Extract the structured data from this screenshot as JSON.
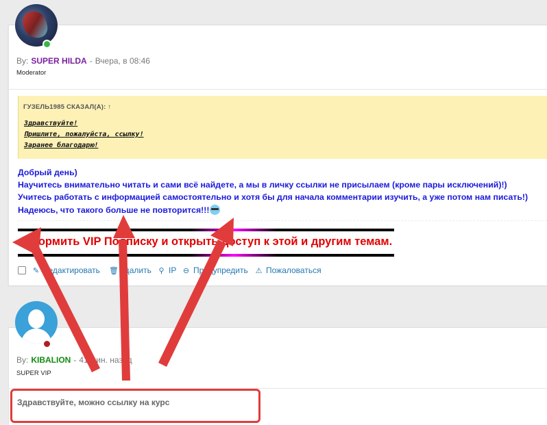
{
  "post1": {
    "by_label": "By:",
    "author": "SUPER HILDA",
    "author_color": "#7a1fa0",
    "separator": "-",
    "time": "Вчера, в 08:46",
    "role": "Moderator",
    "quote": {
      "header": "ГУЗЕЛЬ1985 СКАЗАЛ(А): ↑",
      "lines": [
        "Здравствуйте!",
        "Пришлите, пожалуйста, ссылку!",
        "Заранее благодарю!"
      ]
    },
    "reply_lines": [
      "Добрый день)",
      "Научитесь внимательно читать и сами всё найдете, а мы в личку ссылки не присылаем (кроме пары исключений)!)",
      "Учитесь работать с информацией самостоятельно и хотя бы для начала комментарии изучить, а уже потом нам писать!)",
      "Надеюсь, что такого больше не повторится!!!"
    ],
    "vip_banner": "Оформить VIP Подписку и открыть доступ к этой и другим темам.",
    "actions": [
      {
        "label": "Редактировать",
        "icon": "edit-icon"
      },
      {
        "label": "Удалить",
        "icon": "trash-icon"
      },
      {
        "label": "IP",
        "icon": "user-ip-icon"
      },
      {
        "label": "Предупредить",
        "icon": "warn-circle-icon"
      },
      {
        "label": "Пожаловаться",
        "icon": "report-triangle-icon"
      }
    ]
  },
  "post2": {
    "by_label": "By:",
    "author": "KIBALION",
    "author_color": "#118a11",
    "separator": "-",
    "time": "41 мин. назад",
    "role": "SUPER VIP",
    "message": "Здравствуйте, можно ссылку на курс"
  },
  "colors": {
    "link": "#2577b1",
    "reply_text": "#1a1adb",
    "vip_text": "#e00000",
    "annotation_red": "#e03c3c",
    "quote_bg": "#fdf1b5"
  }
}
